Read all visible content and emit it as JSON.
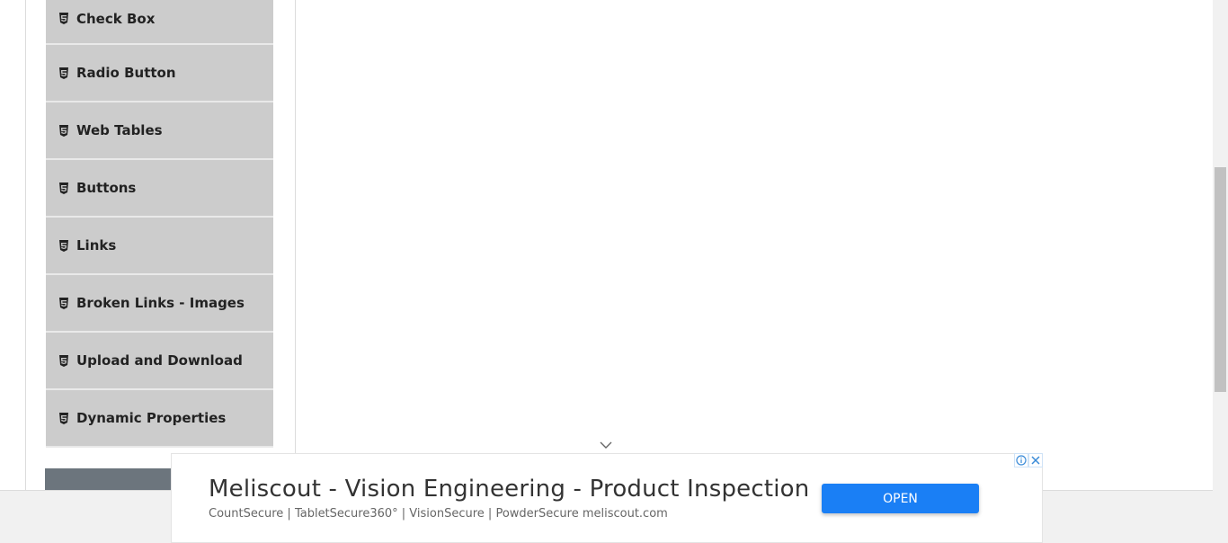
{
  "sidebar": {
    "items": [
      {
        "label": "Check Box"
      },
      {
        "label": "Radio Button"
      },
      {
        "label": "Web Tables"
      },
      {
        "label": "Buttons"
      },
      {
        "label": "Links"
      },
      {
        "label": "Broken Links - Images"
      },
      {
        "label": "Upload and Download"
      },
      {
        "label": "Dynamic Properties"
      }
    ],
    "icon": "html5-icon"
  },
  "ad": {
    "title": "Meliscout - Vision Engineering - Product Inspection",
    "subtitle": "CountSecure | TabletSecure360° | VisionSecure | PowderSecure meliscout.com",
    "open_label": "OPEN",
    "accent": "#1a7ff5"
  }
}
